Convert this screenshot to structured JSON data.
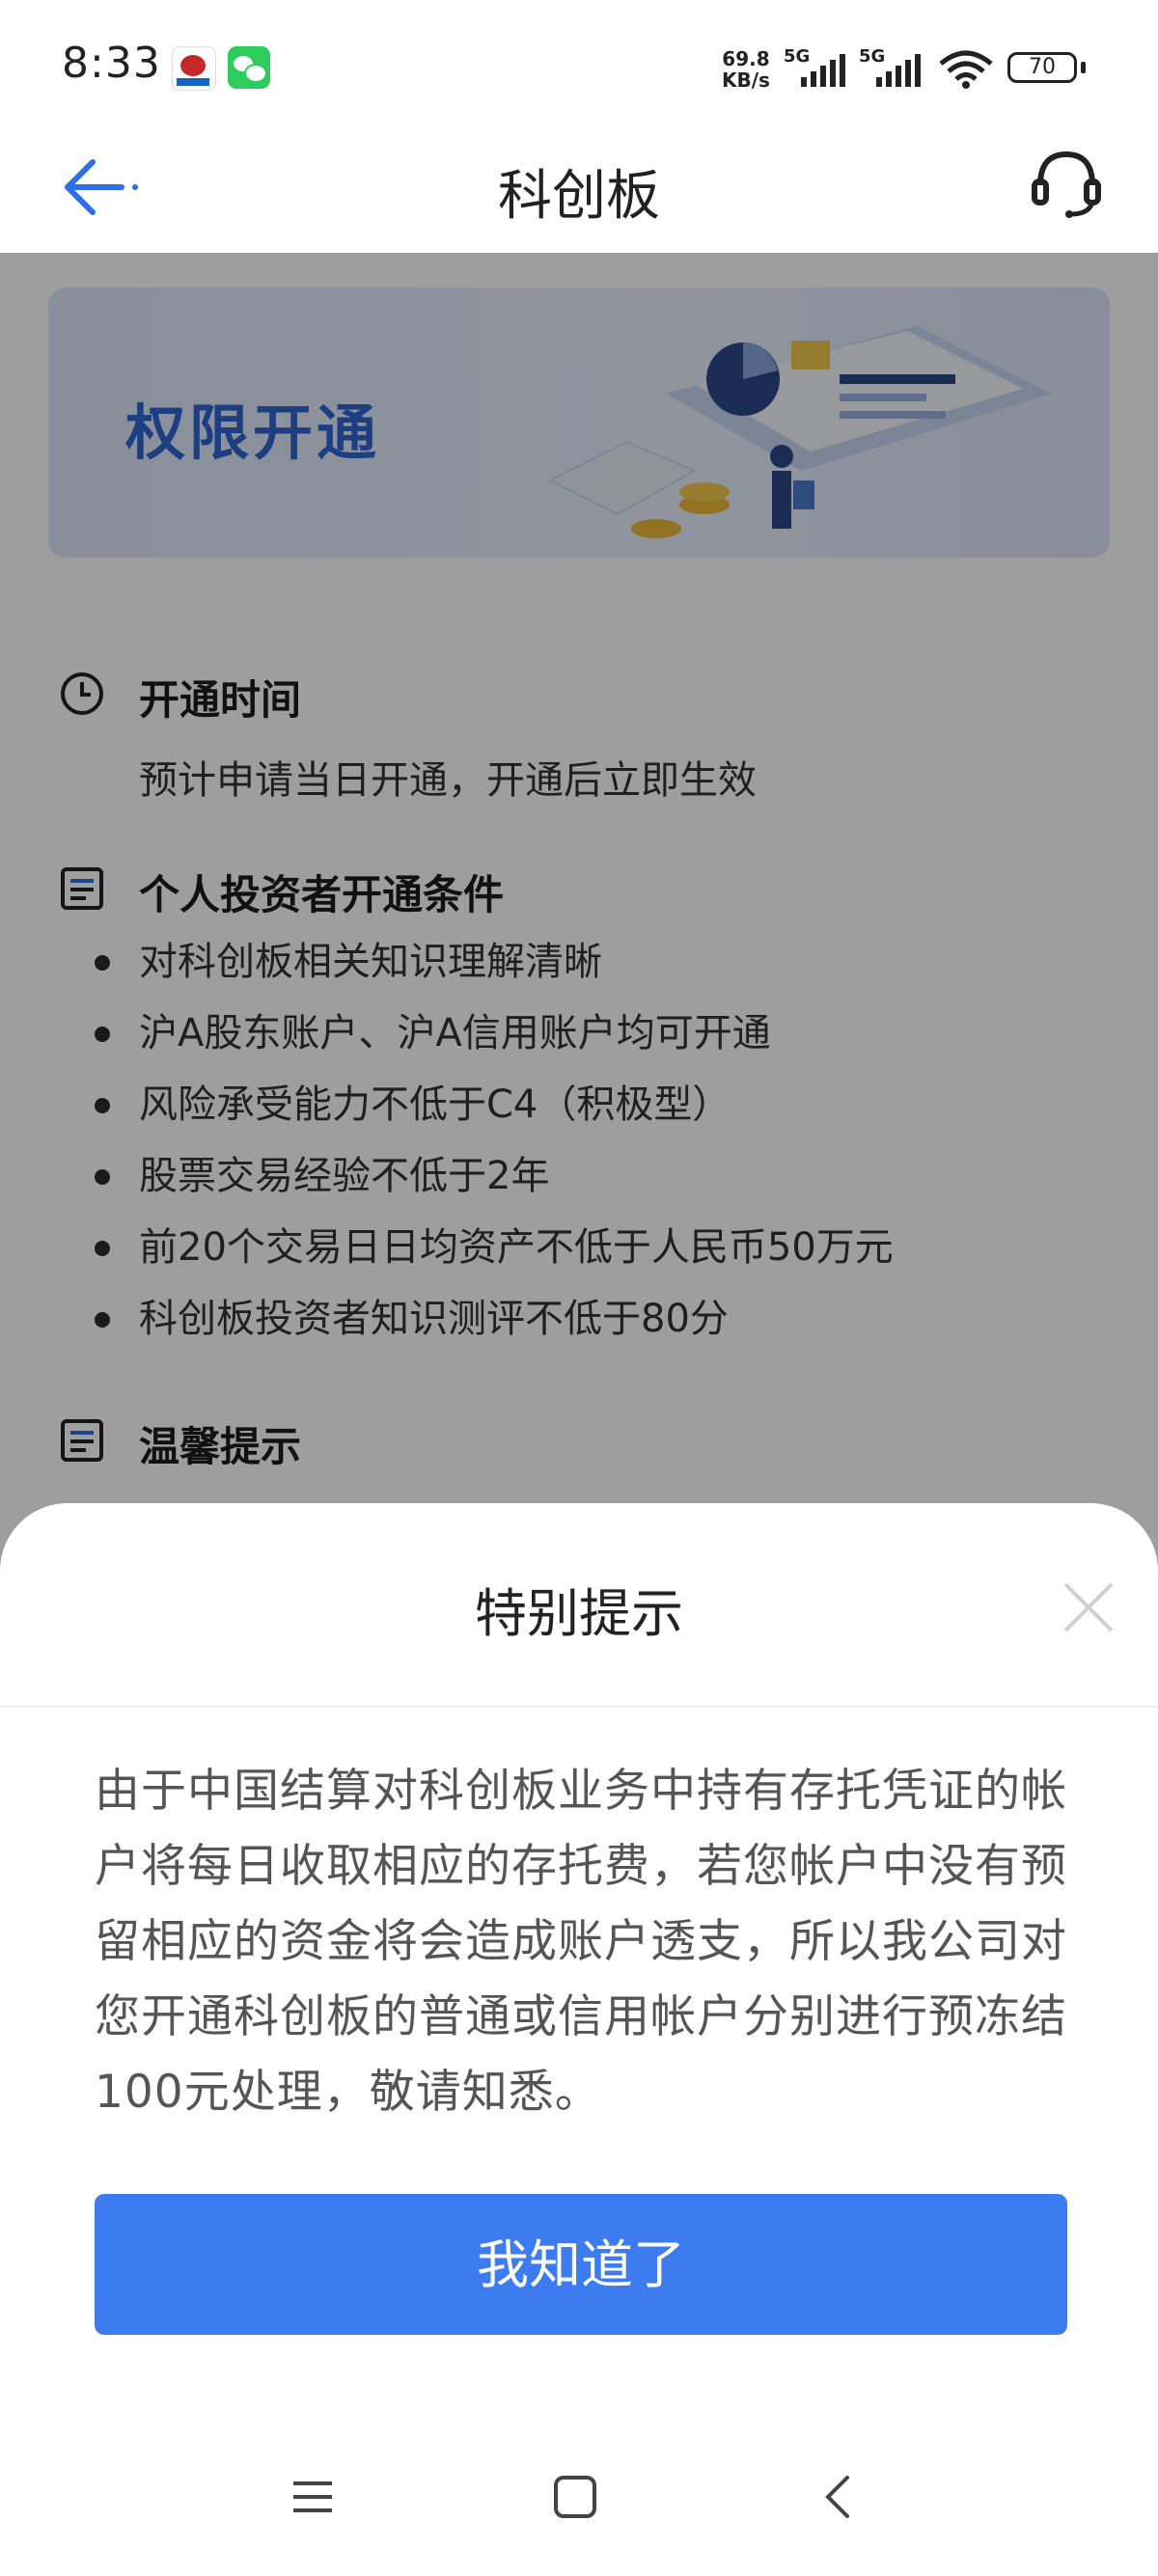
{
  "status_bar": {
    "time": "8:33",
    "net_speed_value": "69.8",
    "net_speed_unit": "KB/s",
    "sim1": "5G",
    "sim2": "5G",
    "battery": "70"
  },
  "nav": {
    "title": "科创板",
    "back_icon": "arrow-left-icon",
    "service_icon": "headset-icon"
  },
  "banner": {
    "title": "权限开通"
  },
  "sections": {
    "open_time": {
      "title": "开通时间",
      "text": "预计申请当日开通，开通后立即生效"
    },
    "conditions": {
      "title": "个人投资者开通条件",
      "items": [
        "对科创板相关知识理解清晰",
        "沪A股东账户、沪A信用账户均可开通",
        "风险承受能力不低于C4（积极型）",
        "股票交易经验不低于2年",
        "前20个交易日日均资产不低于人民币50万元",
        "科创板投资者知识测评不低于80分"
      ]
    },
    "tips": {
      "title": "温馨提示"
    }
  },
  "dialog": {
    "title": "特别提示",
    "body": "由于中国结算对科创板业务中持有存托凭证的帐户将每日收取相应的存托费，若您帐户中没有预留相应的资金将会造成账户透支，所以我公司对您开通科创板的普通或信用帐户分别进行预冻结100元处理，敬请知悉。",
    "button": "我知道了"
  },
  "colors": {
    "accent": "#3d7bf0",
    "banner_text": "#2f66d0"
  }
}
